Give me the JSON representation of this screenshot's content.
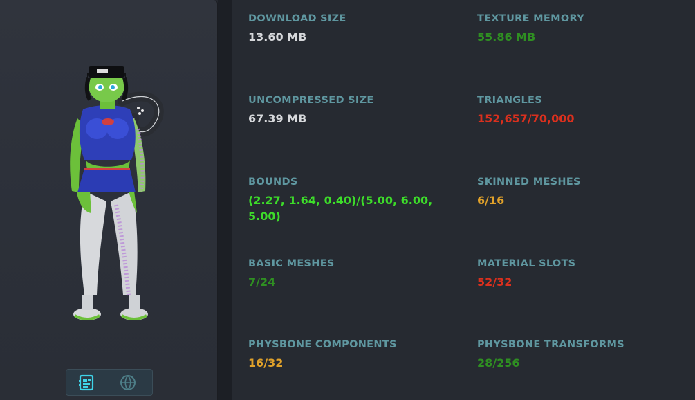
{
  "colors": {
    "label": "#5f97a0",
    "neutral": "#d6d8db",
    "good": "#2f8f22",
    "excellent": "#3ddc2a",
    "medium": "#e0a12a",
    "poor": "#d9301e"
  },
  "preview": {
    "toggle_icons": [
      "details-icon",
      "globe-icon"
    ]
  },
  "stats": [
    {
      "label": "DOWNLOAD SIZE",
      "value": "13.60 MB",
      "rating": "neutral"
    },
    {
      "label": "TEXTURE MEMORY",
      "value": "55.86 MB",
      "rating": "good"
    },
    {
      "label": "UNCOMPRESSED SIZE",
      "value": "67.39 MB",
      "rating": "neutral"
    },
    {
      "label": "TRIANGLES",
      "value": "152,657/70,000",
      "rating": "poor"
    },
    {
      "label": "BOUNDS",
      "value": "(2.27, 1.64, 0.40)/(5.00, 6.00, 5.00)",
      "rating": "excellent"
    },
    {
      "label": "SKINNED MESHES",
      "value": "6/16",
      "rating": "medium"
    },
    {
      "label": "BASIC MESHES",
      "value": "7/24",
      "rating": "good"
    },
    {
      "label": "MATERIAL SLOTS",
      "value": "52/32",
      "rating": "poor"
    },
    {
      "label": "PHYSBONE COMPONENTS",
      "value": "16/32",
      "rating": "medium"
    },
    {
      "label": "PHYSBONE TRANSFORMS",
      "value": "28/256",
      "rating": "good"
    }
  ]
}
